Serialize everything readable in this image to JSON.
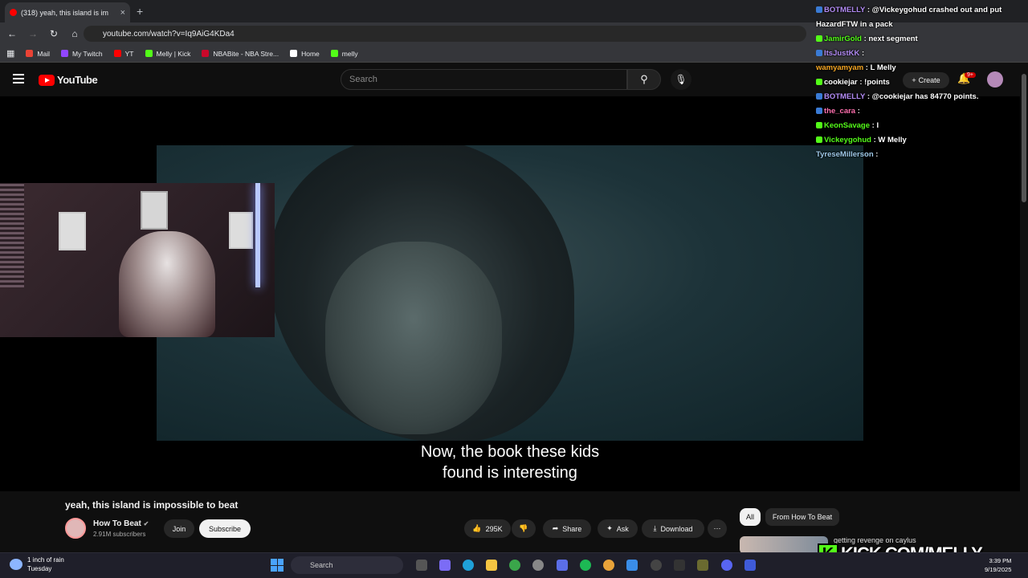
{
  "browser": {
    "tab_title": "(318) yeah, this island is im",
    "new_tab": "+",
    "url": "youtube.com/watch?v=Iq9AiG4KDa4",
    "bookmarks": [
      {
        "label": "Mail",
        "color": "#ea4335"
      },
      {
        "label": "My Twitch",
        "color": "#9146ff"
      },
      {
        "label": "YT",
        "color": "#ff0000"
      },
      {
        "label": "Melly | Kick",
        "color": "#53fc18"
      },
      {
        "label": "NBABite - NBA Stre...",
        "color": "#c9082a"
      },
      {
        "label": "Home",
        "color": "#ffffff"
      },
      {
        "label": "melly",
        "color": "#53fc18"
      }
    ]
  },
  "youtube": {
    "logo": "YouTube",
    "search_placeholder": "Search",
    "create_label": "Create",
    "notifications_badge": "9+",
    "subtitle_line1": "Now, the book these kids",
    "subtitle_line2": "found is interesting",
    "video_title": "yeah, this island is impossible to beat",
    "channel_name": "How To Beat",
    "channel_subs": "2.91M subscribers",
    "join_label": "Join",
    "subscribe_label": "Subscribe",
    "like_count": "295K",
    "share_label": "Share",
    "ask_label": "Ask",
    "download_label": "Download",
    "chips": [
      "All",
      "From How To Beat"
    ],
    "rec_title": "getting revenge on caylus"
  },
  "chat": [
    {
      "user": "BOTMELLY",
      "color": "#b28bf4",
      "text": "@Vickeygohud crashed out and put HazardFTW in a pack"
    },
    {
      "user": "JamirGold",
      "color": "#53fc18",
      "text": "next segment"
    },
    {
      "user": "ItsJustKK",
      "color": "#b28bf4",
      "text": ""
    },
    {
      "user": "wamyamyam",
      "color": "#f5a623",
      "text": "L Melly"
    },
    {
      "user": "cookiejar",
      "color": "#ffffff",
      "text": "!points"
    },
    {
      "user": "BOTMELLY",
      "color": "#b28bf4",
      "text": "@cookiejar has 84770 points."
    },
    {
      "user": "the_cara",
      "color": "#ff6fae",
      "text": ""
    },
    {
      "user": "KeonSavage",
      "color": "#53fc18",
      "text": "I"
    },
    {
      "user": "Vickeygohud",
      "color": "#53fc18",
      "text": "W Melly"
    },
    {
      "user": "TyreseMillerson",
      "color": "#9ec9e8",
      "text": ""
    }
  ],
  "overlay": {
    "kick_letter": "K",
    "kick_text": "KICK.COM/MELLY"
  },
  "taskbar": {
    "weather_line1": "1 inch of rain",
    "weather_line2": "Tuesday",
    "search_placeholder": "Search",
    "time": "3:39 PM",
    "date": "9/19/2025"
  }
}
